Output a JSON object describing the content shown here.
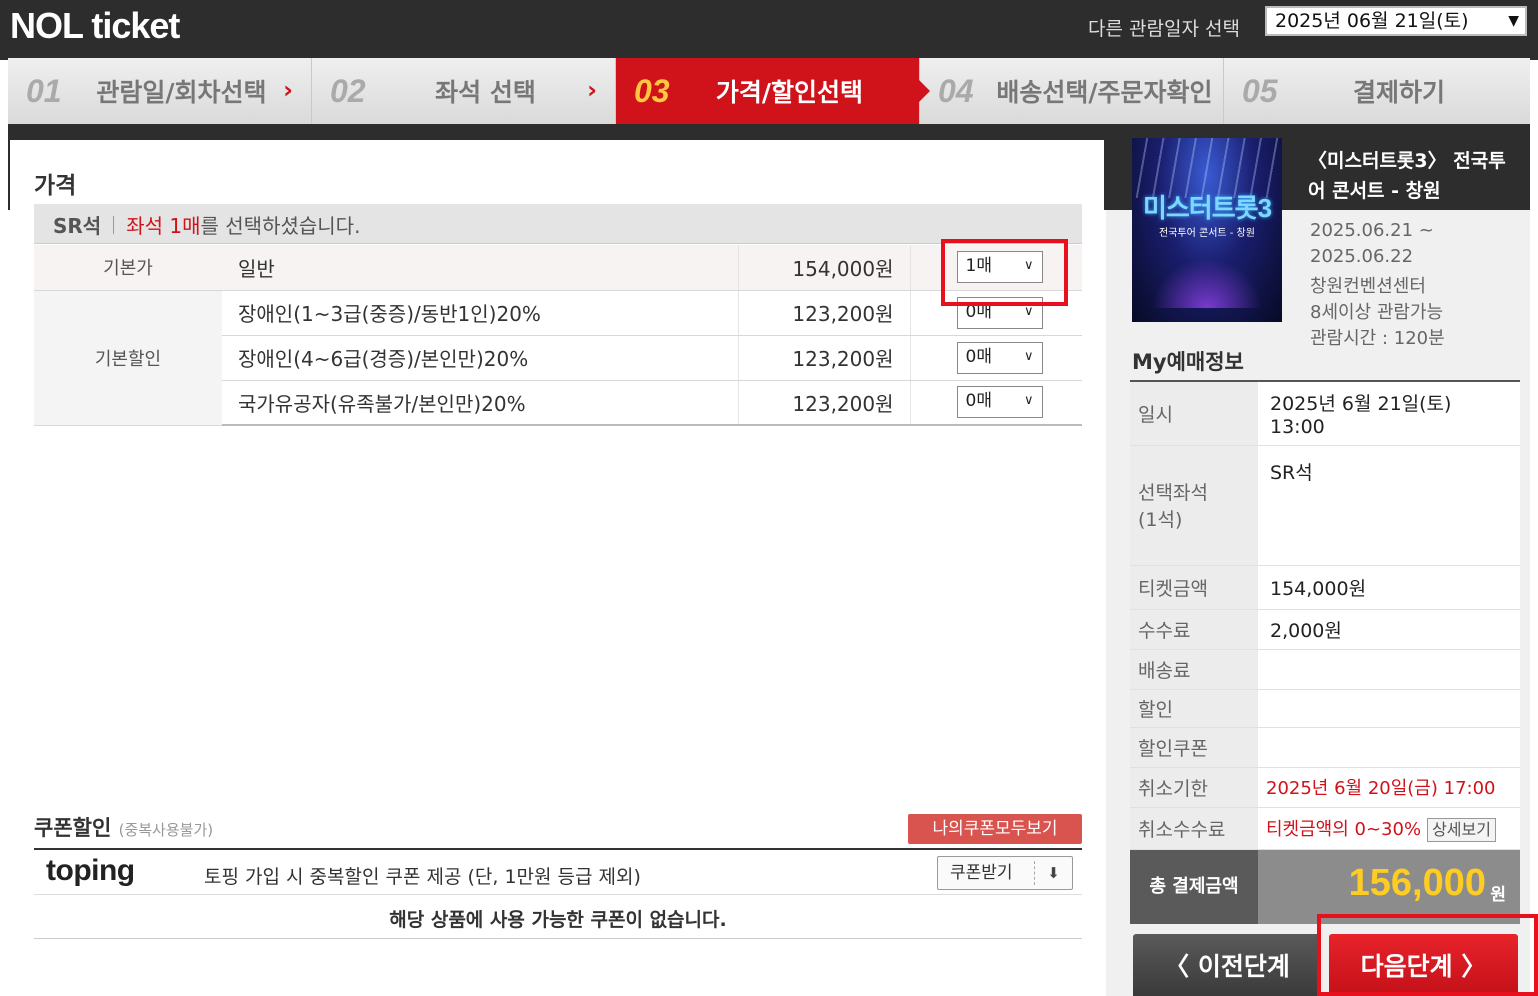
{
  "header": {
    "logo": "NOL ticket",
    "other_date_label": "다른 관람일자 선택",
    "date_select_value": "2025년 06월 21일(토)"
  },
  "steps": [
    {
      "num": "01",
      "label": "관람일/회차선택",
      "arrow": "›"
    },
    {
      "num": "02",
      "label": "좌석 선택",
      "arrow": "›"
    },
    {
      "num": "03",
      "label": "가격/할인선택",
      "active": true
    },
    {
      "num": "04",
      "label": "배송선택/주문자확인"
    },
    {
      "num": "05",
      "label": "결제하기"
    }
  ],
  "price": {
    "title": "가격",
    "seat_grade": "SR석",
    "selected_highlight": "좌석 1매",
    "selected_suffix": "를 선택하셨습니다.",
    "rows": [
      {
        "category": "기본가",
        "name": "일반",
        "amount": "154,000원",
        "qty": "1매"
      },
      {
        "category": "기본할인",
        "name": "장애인(1~3급(중증)/동반1인)20%",
        "amount": "123,200원",
        "qty": "0매"
      },
      {
        "category": "",
        "name": "장애인(4~6급(경증)/본인만)20%",
        "amount": "123,200원",
        "qty": "0매"
      },
      {
        "category": "",
        "name": "국가유공자(유족불가/본인만)20%",
        "amount": "123,200원",
        "qty": "0매"
      }
    ]
  },
  "coupon": {
    "title": "쿠폰할인",
    "subtitle": "(중복사용불가)",
    "my_coupon_button": "나의쿠폰모두보기",
    "toping_logo": "toping",
    "toping_text": "토핑 가입 시 중복할인 쿠폰 제공 (단, 1만원 등급 제외)",
    "get_coupon_button": "쿠폰받기",
    "no_coupon_text": "해당 상품에 사용 가능한 쿠폰이 없습니다."
  },
  "show": {
    "poster_title": "미스터트롯3",
    "poster_subtitle": "전국투어 콘서트 - 창원",
    "title": "〈미스터트롯3〉 전국투어 콘서트 - 창원",
    "period_start": "2025.06.21 ~",
    "period_end": "2025.06.22",
    "venue": "창원컨벤션센터",
    "age": "8세이상 관람가능",
    "runtime": "관람시간 : 120분"
  },
  "my_info": {
    "title": "My예매정보",
    "datetime_label": "일시",
    "datetime_date": "2025년 6월 21일(토)",
    "datetime_time": "13:00",
    "seat_label": "선택좌석",
    "seat_count": "(1석)",
    "seat_value": "SR석",
    "ticket_label": "티켓금액",
    "ticket_value": "154,000원",
    "fee_label": "수수료",
    "fee_value": "2,000원",
    "delivery_label": "배송료",
    "discount_label": "할인",
    "coupon_label": "할인쿠폰",
    "cancel_deadline_label": "취소기한",
    "cancel_deadline_value": "2025년 6월 20일(금) 17:00",
    "cancel_fee_label": "취소수수료",
    "cancel_fee_value": "티켓금액의 0~30%",
    "detail_button": "상세보기",
    "total_label": "총 결제금액",
    "total_value": "156,000",
    "total_unit": "원"
  },
  "nav": {
    "prev_label": "〈  이전단계",
    "next_label": "다음단계  〉"
  },
  "colors": {
    "accent_red": "#d0121a",
    "header_dark": "#2d2d2d",
    "total_yellow": "#ffcc22"
  }
}
